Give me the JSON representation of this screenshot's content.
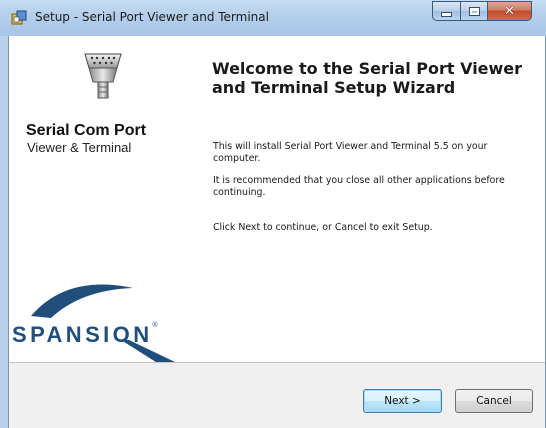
{
  "window": {
    "title": "Setup - Serial Port Viewer and Terminal",
    "app_icon": "installer-icon",
    "controls": {
      "minimize_icon": "minimize-icon",
      "maximize_icon": "maximize-icon",
      "close_icon": "close-icon"
    }
  },
  "sidebar": {
    "icon": "serial-connector-icon",
    "product_name": "Serial Com Port",
    "product_sub": "Viewer & Terminal",
    "logo_text": "SPANSION",
    "logo_mark": "®"
  },
  "main": {
    "title": "Welcome to the Serial Port Viewer and Terminal Setup Wizard",
    "paragraphs": [
      "This will install Serial Port Viewer and Terminal 5.5 on your computer.",
      "It is recommended that you close all other applications before continuing.",
      "Click Next to continue, or Cancel to exit Setup."
    ]
  },
  "footer": {
    "next_label": "Next >",
    "cancel_label": "Cancel"
  },
  "colors": {
    "logo_blue": "#1f4f7a",
    "frame": "#b9d1ea",
    "close_red": "#c04c2e"
  }
}
